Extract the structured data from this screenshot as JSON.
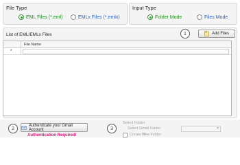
{
  "file_type": {
    "title": "File Type",
    "options": [
      {
        "label": "EML Files (*.eml)",
        "selected": true,
        "color": "#1f8a1f"
      },
      {
        "label": "EMLx Files (*.emlx)",
        "selected": false,
        "color": "#2b5fb8"
      }
    ]
  },
  "input_type": {
    "title": "Input Type",
    "options": [
      {
        "label": "Folder Mode",
        "selected": true,
        "color": "#1f8a1f"
      },
      {
        "label": "Files Mode",
        "selected": false,
        "color": "#2b5fb8"
      }
    ]
  },
  "files_list": {
    "label": "List of EML/EMLx Files",
    "step": "1",
    "add_button": "Add Files",
    "column_header": "File Name",
    "row_marker": "*"
  },
  "gmail": {
    "step": "2",
    "auth_button": "Authenticate your Gmail Account",
    "auth_status": "Authentication Required!",
    "auth_status_color": "#d4147a"
  },
  "folder": {
    "step": "3",
    "select_folder": "Select Folder",
    "select_gmail_folder": "Select Gmail Folder",
    "or_label": "or",
    "create_new_folder": "Create New Folder"
  }
}
